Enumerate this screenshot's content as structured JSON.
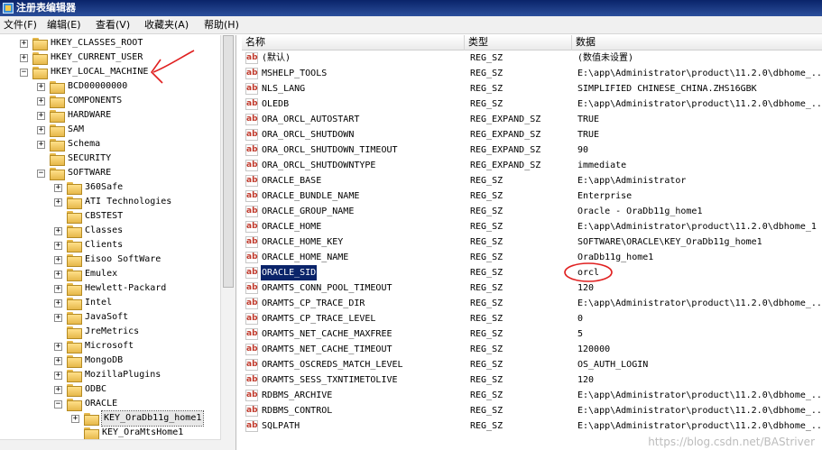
{
  "window": {
    "title": "注册表编辑器"
  },
  "menu": [
    {
      "label": "文件(F)"
    },
    {
      "label": "编辑(E)"
    },
    {
      "label": "查看(V)"
    },
    {
      "label": "收藏夹(A)"
    },
    {
      "label": "帮助(H)"
    }
  ],
  "tree": {
    "items": [
      {
        "label": "HKEY_CLASSES_ROOT",
        "expander": "+"
      },
      {
        "label": "HKEY_CURRENT_USER",
        "expander": "+"
      },
      {
        "label": "HKEY_LOCAL_MACHINE",
        "expander": "-"
      },
      {
        "label": "BCD00000000",
        "expander": "+"
      },
      {
        "label": "COMPONENTS",
        "expander": "+"
      },
      {
        "label": "HARDWARE",
        "expander": "+"
      },
      {
        "label": "SAM",
        "expander": "+"
      },
      {
        "label": "Schema",
        "expander": "+"
      },
      {
        "label": "SECURITY",
        "expander": ""
      },
      {
        "label": "SOFTWARE",
        "expander": "-"
      },
      {
        "label": "360Safe",
        "expander": "+"
      },
      {
        "label": "ATI Technologies",
        "expander": "+"
      },
      {
        "label": "CBSTEST",
        "expander": ""
      },
      {
        "label": "Classes",
        "expander": "+"
      },
      {
        "label": "Clients",
        "expander": "+"
      },
      {
        "label": "Eisoo SoftWare",
        "expander": "+"
      },
      {
        "label": "Emulex",
        "expander": "+"
      },
      {
        "label": "Hewlett-Packard",
        "expander": "+"
      },
      {
        "label": "Intel",
        "expander": "+"
      },
      {
        "label": "JavaSoft",
        "expander": "+"
      },
      {
        "label": "JreMetrics",
        "expander": ""
      },
      {
        "label": "Microsoft",
        "expander": "+"
      },
      {
        "label": "MongoDB",
        "expander": "+"
      },
      {
        "label": "MozillaPlugins",
        "expander": "+"
      },
      {
        "label": "ODBC",
        "expander": "+"
      },
      {
        "label": "ORACLE",
        "expander": "-"
      },
      {
        "label": "KEY_OraDb11g_home1",
        "expander": "+"
      },
      {
        "label": "KEY_OraMtsHome1",
        "expander": ""
      }
    ]
  },
  "list": {
    "columns": {
      "name": "名称",
      "type": "类型",
      "data": "数据"
    },
    "rows": [
      {
        "name": "(默认)",
        "type": "REG_SZ",
        "data": "(数值未设置)"
      },
      {
        "name": "MSHELP_TOOLS",
        "type": "REG_SZ",
        "data": "E:\\app\\Administrator\\product\\11.2.0\\dbhome_..."
      },
      {
        "name": "NLS_LANG",
        "type": "REG_SZ",
        "data": "SIMPLIFIED CHINESE_CHINA.ZHS16GBK"
      },
      {
        "name": "OLEDB",
        "type": "REG_SZ",
        "data": "E:\\app\\Administrator\\product\\11.2.0\\dbhome_..."
      },
      {
        "name": "ORA_ORCL_AUTOSTART",
        "type": "REG_EXPAND_SZ",
        "data": "TRUE"
      },
      {
        "name": "ORA_ORCL_SHUTDOWN",
        "type": "REG_EXPAND_SZ",
        "data": "TRUE"
      },
      {
        "name": "ORA_ORCL_SHUTDOWN_TIMEOUT",
        "type": "REG_EXPAND_SZ",
        "data": "90"
      },
      {
        "name": "ORA_ORCL_SHUTDOWNTYPE",
        "type": "REG_EXPAND_SZ",
        "data": "immediate"
      },
      {
        "name": "ORACLE_BASE",
        "type": "REG_SZ",
        "data": "E:\\app\\Administrator"
      },
      {
        "name": "ORACLE_BUNDLE_NAME",
        "type": "REG_SZ",
        "data": "Enterprise"
      },
      {
        "name": "ORACLE_GROUP_NAME",
        "type": "REG_SZ",
        "data": "Oracle - OraDb11g_home1"
      },
      {
        "name": "ORACLE_HOME",
        "type": "REG_SZ",
        "data": "E:\\app\\Administrator\\product\\11.2.0\\dbhome_1"
      },
      {
        "name": "ORACLE_HOME_KEY",
        "type": "REG_SZ",
        "data": "SOFTWARE\\ORACLE\\KEY_OraDb11g_home1"
      },
      {
        "name": "ORACLE_HOME_NAME",
        "type": "REG_SZ",
        "data": "OraDb11g_home1"
      },
      {
        "name": "ORACLE_SID",
        "type": "REG_SZ",
        "data": "orcl"
      },
      {
        "name": "ORAMTS_CONN_POOL_TIMEOUT",
        "type": "REG_SZ",
        "data": "120"
      },
      {
        "name": "ORAMTS_CP_TRACE_DIR",
        "type": "REG_SZ",
        "data": "E:\\app\\Administrator\\product\\11.2.0\\dbhome_..."
      },
      {
        "name": "ORAMTS_CP_TRACE_LEVEL",
        "type": "REG_SZ",
        "data": "0"
      },
      {
        "name": "ORAMTS_NET_CACHE_MAXFREE",
        "type": "REG_SZ",
        "data": "5"
      },
      {
        "name": "ORAMTS_NET_CACHE_TIMEOUT",
        "type": "REG_SZ",
        "data": "120000"
      },
      {
        "name": "ORAMTS_OSCREDS_MATCH_LEVEL",
        "type": "REG_SZ",
        "data": "OS_AUTH_LOGIN"
      },
      {
        "name": "ORAMTS_SESS_TXNTIMETOLIVE",
        "type": "REG_SZ",
        "data": "120"
      },
      {
        "name": "RDBMS_ARCHIVE",
        "type": "REG_SZ",
        "data": "E:\\app\\Administrator\\product\\11.2.0\\dbhome_..."
      },
      {
        "name": "RDBMS_CONTROL",
        "type": "REG_SZ",
        "data": "E:\\app\\Administrator\\product\\11.2.0\\dbhome_..."
      },
      {
        "name": "SQLPATH",
        "type": "REG_SZ",
        "data": "E:\\app\\Administrator\\product\\11.2.0\\dbhome_..."
      }
    ]
  },
  "value_icon": "ab",
  "watermark": "https://blog.csdn.net/BAStriver",
  "colors": {
    "annotation": "#e02020",
    "selection": "#0a246a"
  }
}
